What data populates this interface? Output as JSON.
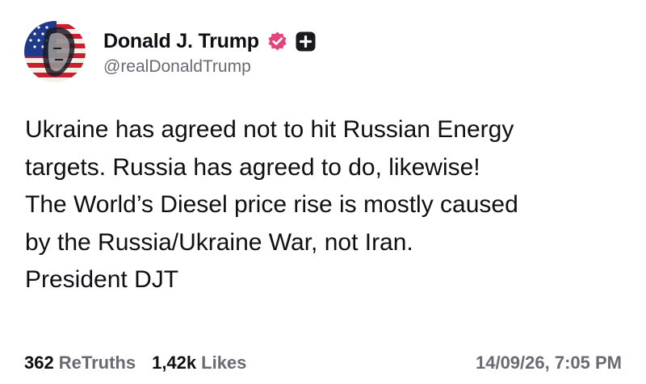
{
  "post": {
    "author": {
      "display_name": "Donald J. Trump",
      "handle": "@realDonaldTrump",
      "avatar": "avatar-flag-portrait",
      "verified_icon": "verified-badge-icon",
      "plus_icon": "plus-badge-icon"
    },
    "content_lines": [
      "Ukraine has agreed not to hit Russian Energy",
      "targets. Russia has agreed to do, likewise!",
      "The World’s Diesel price rise is mostly caused",
      "by the Russia/Ukraine War, not Iran.",
      "President DJT"
    ],
    "stats": {
      "retruths_count": "362",
      "retruths_label": "ReTruths",
      "likes_count": "1,42k",
      "likes_label": "Likes"
    },
    "timestamp": "14/09/26, 7:05 PM"
  },
  "colors": {
    "text": "#0f0f14",
    "muted": "#6a6a72",
    "verified": "#e0457b",
    "plus_badge": "#1a1a1f",
    "background": "#ffffff"
  }
}
